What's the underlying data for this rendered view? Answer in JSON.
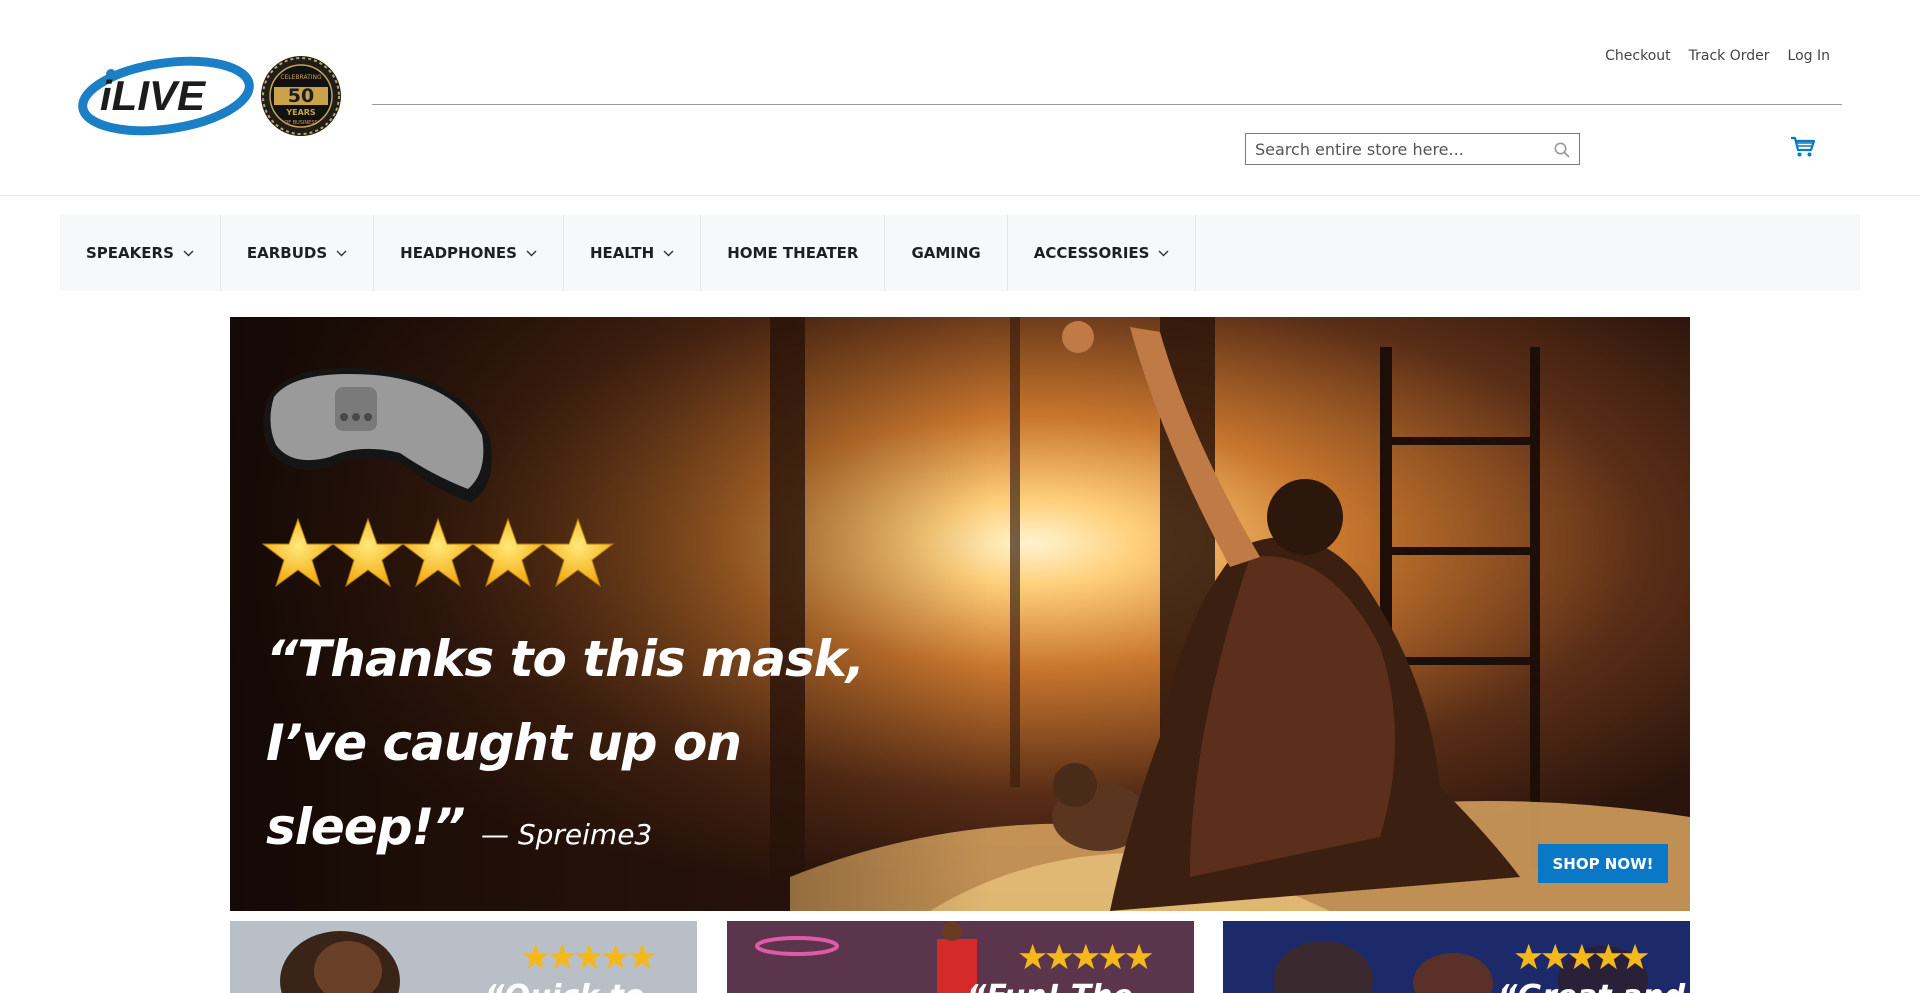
{
  "header": {
    "logo_text": "iLIVE",
    "badge_lines": [
      "CELEBRATING",
      "50",
      "YEARS",
      "OF BUSINESS"
    ],
    "top_links": [
      "Checkout",
      "Track Order",
      "Log In"
    ],
    "search_placeholder": "Search entire store here..."
  },
  "nav": {
    "items": [
      {
        "label": "SPEAKERS",
        "has_dropdown": true
      },
      {
        "label": "EARBUDS",
        "has_dropdown": true
      },
      {
        "label": "HEADPHONES",
        "has_dropdown": true
      },
      {
        "label": "HEALTH",
        "has_dropdown": true
      },
      {
        "label": "HOME THEATER",
        "has_dropdown": false
      },
      {
        "label": "GAMING",
        "has_dropdown": false
      },
      {
        "label": "ACCESSORIES",
        "has_dropdown": true
      }
    ]
  },
  "hero": {
    "rating_stars": 5,
    "quote_line1": "“Thanks to this mask,",
    "quote_line2": "I’ve caught up on",
    "quote_line3": "sleep!”",
    "quote_author": "— Spreime3",
    "cta_label": "SHOP NOW!"
  },
  "tiles": [
    {
      "rating_stars": 5,
      "quote_start": "“Quick to"
    },
    {
      "rating_stars": 5,
      "quote_start": "“Fun! The"
    },
    {
      "rating_stars": 5,
      "quote_start": "“Great and"
    }
  ],
  "colors": {
    "accent": "#0a78c6",
    "star": "#f5b81c",
    "nav_bg": "#f7f8f9"
  }
}
